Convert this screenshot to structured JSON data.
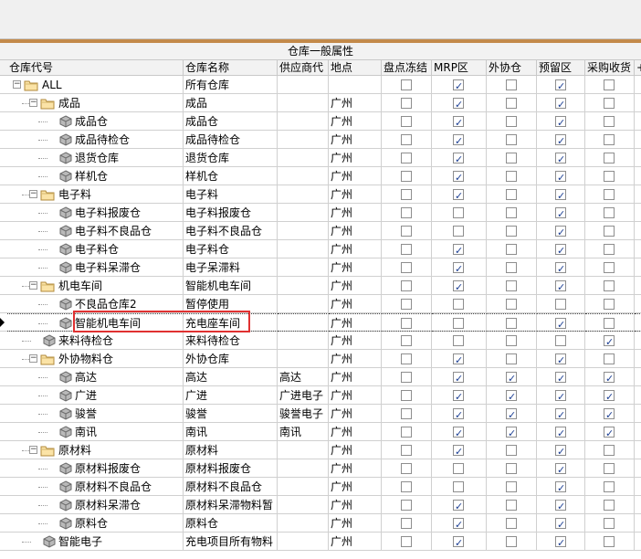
{
  "header": {
    "group_title": "仓库一般属性",
    "columns": [
      "仓库代号",
      "仓库名称",
      "供应商代",
      "地点",
      "盘点冻结",
      "MRP区",
      "外协仓",
      "预留区",
      "采购收货",
      "+"
    ]
  },
  "rows": [
    {
      "code": "ALL",
      "name": "所有仓库",
      "supplier": "",
      "location": "",
      "level": 0,
      "node": "folder",
      "checks": [
        false,
        true,
        false,
        true,
        false
      ]
    },
    {
      "code": "成品",
      "name": "成品",
      "supplier": "",
      "location": "广州",
      "level": 1,
      "node": "folder",
      "checks": [
        false,
        true,
        false,
        true,
        false
      ]
    },
    {
      "code": "成品仓",
      "name": "成品仓",
      "supplier": "",
      "location": "广州",
      "level": 2,
      "node": "leaf",
      "checks": [
        false,
        true,
        false,
        true,
        false
      ]
    },
    {
      "code": "成品待检仓",
      "name": "成品待检仓",
      "supplier": "",
      "location": "广州",
      "level": 2,
      "node": "leaf",
      "checks": [
        false,
        true,
        false,
        true,
        false
      ]
    },
    {
      "code": "退货仓库",
      "name": "退货仓库",
      "supplier": "",
      "location": "广州",
      "level": 2,
      "node": "leaf",
      "checks": [
        false,
        true,
        false,
        true,
        false
      ]
    },
    {
      "code": "样机仓",
      "name": "样机仓",
      "supplier": "",
      "location": "广州",
      "level": 2,
      "node": "leaf",
      "checks": [
        false,
        true,
        false,
        true,
        false
      ]
    },
    {
      "code": "电子料",
      "name": "电子料",
      "supplier": "",
      "location": "广州",
      "level": 1,
      "node": "folder",
      "checks": [
        false,
        true,
        false,
        true,
        false
      ]
    },
    {
      "code": "电子料报废仓",
      "name": "电子料报废仓",
      "supplier": "",
      "location": "广州",
      "level": 2,
      "node": "leaf",
      "checks": [
        false,
        false,
        false,
        true,
        false
      ]
    },
    {
      "code": "电子料不良品仓",
      "name": "电子料不良品仓",
      "supplier": "",
      "location": "广州",
      "level": 2,
      "node": "leaf",
      "checks": [
        false,
        false,
        false,
        true,
        false
      ]
    },
    {
      "code": "电子料仓",
      "name": "电子料仓",
      "supplier": "",
      "location": "广州",
      "level": 2,
      "node": "leaf",
      "checks": [
        false,
        true,
        false,
        true,
        false
      ]
    },
    {
      "code": "电子料呆滞仓",
      "name": "电子呆滞料",
      "supplier": "",
      "location": "广州",
      "level": 2,
      "node": "leaf",
      "checks": [
        false,
        true,
        false,
        true,
        false
      ]
    },
    {
      "code": "机电车间",
      "name": "智能机电车间",
      "supplier": "",
      "location": "广州",
      "level": 1,
      "node": "folder",
      "checks": [
        false,
        true,
        false,
        true,
        false
      ]
    },
    {
      "code": "不良品仓库2",
      "name": "暂停使用",
      "supplier": "",
      "location": "广州",
      "level": 2,
      "node": "leaf",
      "checks": [
        false,
        false,
        false,
        false,
        false
      ]
    },
    {
      "code": "智能机电车间",
      "name": "充电座车间",
      "supplier": "",
      "location": "广州",
      "level": 2,
      "node": "leaf",
      "selected": true,
      "checks": [
        false,
        false,
        false,
        true,
        false
      ]
    },
    {
      "code": "来料待检仓",
      "name": "来料待检仓",
      "supplier": "",
      "location": "广州",
      "level": 1,
      "node": "leaf",
      "checks": [
        false,
        false,
        false,
        false,
        true
      ]
    },
    {
      "code": "外协物料仓",
      "name": "外协仓库",
      "supplier": "",
      "location": "广州",
      "level": 1,
      "node": "folder",
      "checks": [
        false,
        true,
        false,
        true,
        false
      ]
    },
    {
      "code": "高达",
      "name": "高达",
      "supplier": "高达",
      "location": "广州",
      "level": 2,
      "node": "leaf",
      "checks": [
        false,
        true,
        true,
        true,
        true
      ]
    },
    {
      "code": "广进",
      "name": "广进",
      "supplier": "广进电子",
      "location": "广州",
      "level": 2,
      "node": "leaf",
      "checks": [
        false,
        true,
        true,
        true,
        true
      ]
    },
    {
      "code": "骏誉",
      "name": "骏誉",
      "supplier": "骏誉电子",
      "location": "广州",
      "level": 2,
      "node": "leaf",
      "checks": [
        false,
        true,
        true,
        true,
        true
      ]
    },
    {
      "code": "南讯",
      "name": "南讯",
      "supplier": "南讯",
      "location": "广州",
      "level": 2,
      "node": "leaf",
      "checks": [
        false,
        true,
        true,
        true,
        true
      ]
    },
    {
      "code": "原材料",
      "name": "原材料",
      "supplier": "",
      "location": "广州",
      "level": 1,
      "node": "folder",
      "checks": [
        false,
        true,
        false,
        true,
        false
      ]
    },
    {
      "code": "原材料报废仓",
      "name": "原材料报废仓",
      "supplier": "",
      "location": "广州",
      "level": 2,
      "node": "leaf",
      "checks": [
        false,
        false,
        false,
        true,
        false
      ]
    },
    {
      "code": "原材料不良品仓",
      "name": "原材料不良品仓",
      "supplier": "",
      "location": "广州",
      "level": 2,
      "node": "leaf",
      "checks": [
        false,
        false,
        false,
        true,
        false
      ]
    },
    {
      "code": "原材料呆滞仓",
      "name": "原材料呆滞物料暂",
      "supplier": "",
      "location": "广州",
      "level": 2,
      "node": "leaf",
      "checks": [
        false,
        true,
        false,
        true,
        false
      ]
    },
    {
      "code": "原料仓",
      "name": "原料仓",
      "supplier": "",
      "location": "广州",
      "level": 2,
      "node": "leaf",
      "checks": [
        false,
        true,
        false,
        true,
        false
      ]
    },
    {
      "code": "智能电子",
      "name": "充电项目所有物料",
      "supplier": "",
      "location": "广州",
      "level": 1,
      "node": "leaf",
      "checks": [
        false,
        true,
        false,
        true,
        false
      ]
    }
  ],
  "colors": {
    "accent": "#c38a4a",
    "highlight": "#e03131",
    "check": "#1c3f94"
  }
}
